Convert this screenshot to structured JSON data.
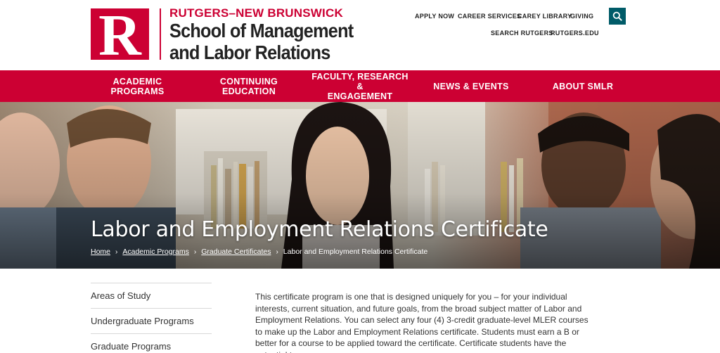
{
  "header": {
    "logo_letter": "R",
    "logo_top": "RUTGERS–NEW BRUNSWICK",
    "logo_line1": "School of Management",
    "logo_line2": "and Labor Relations",
    "util_links": [
      "APPLY NOW",
      "CAREER SERVICES",
      "CAREY LIBRARY",
      "GIVING"
    ],
    "util_links_2": [
      "SEARCH RUTGERS",
      "RUTGERS.EDU"
    ],
    "search_icon": "search-icon"
  },
  "nav": {
    "items": [
      {
        "line1": "ACADEMIC",
        "line2": "PROGRAMS"
      },
      {
        "line1": "CONTINUING",
        "line2": "EDUCATION"
      },
      {
        "line1": "FACULTY, RESEARCH &",
        "line2": "ENGAGEMENT"
      },
      {
        "line1": "NEWS & EVENTS",
        "line2": ""
      },
      {
        "line1": "ABOUT SMLR",
        "line2": ""
      }
    ]
  },
  "hero": {
    "title": "Labor and Employment Relations Certificate",
    "breadcrumb": [
      "Home",
      "Academic Programs",
      "Graduate Certificates",
      "Labor and Employment Relations Certificate"
    ]
  },
  "sidebar": {
    "items": [
      "Areas of Study",
      "Undergraduate Programs",
      "Graduate Programs"
    ]
  },
  "main": {
    "intro": "This certificate program is one that is designed uniquely for you – for your individual interests, current situation, and future goals, from the broad subject matter of Labor and Employment Relations. You can select any four (4) 3-credit graduate-level MLER courses to make up the Labor and Employment Relations certificate. Students must earn a B or better for a course to be applied toward the certificate. Certificate students have the potential to"
  },
  "colors": {
    "brand_red": "#cc0033",
    "search_teal": "#005b68"
  }
}
